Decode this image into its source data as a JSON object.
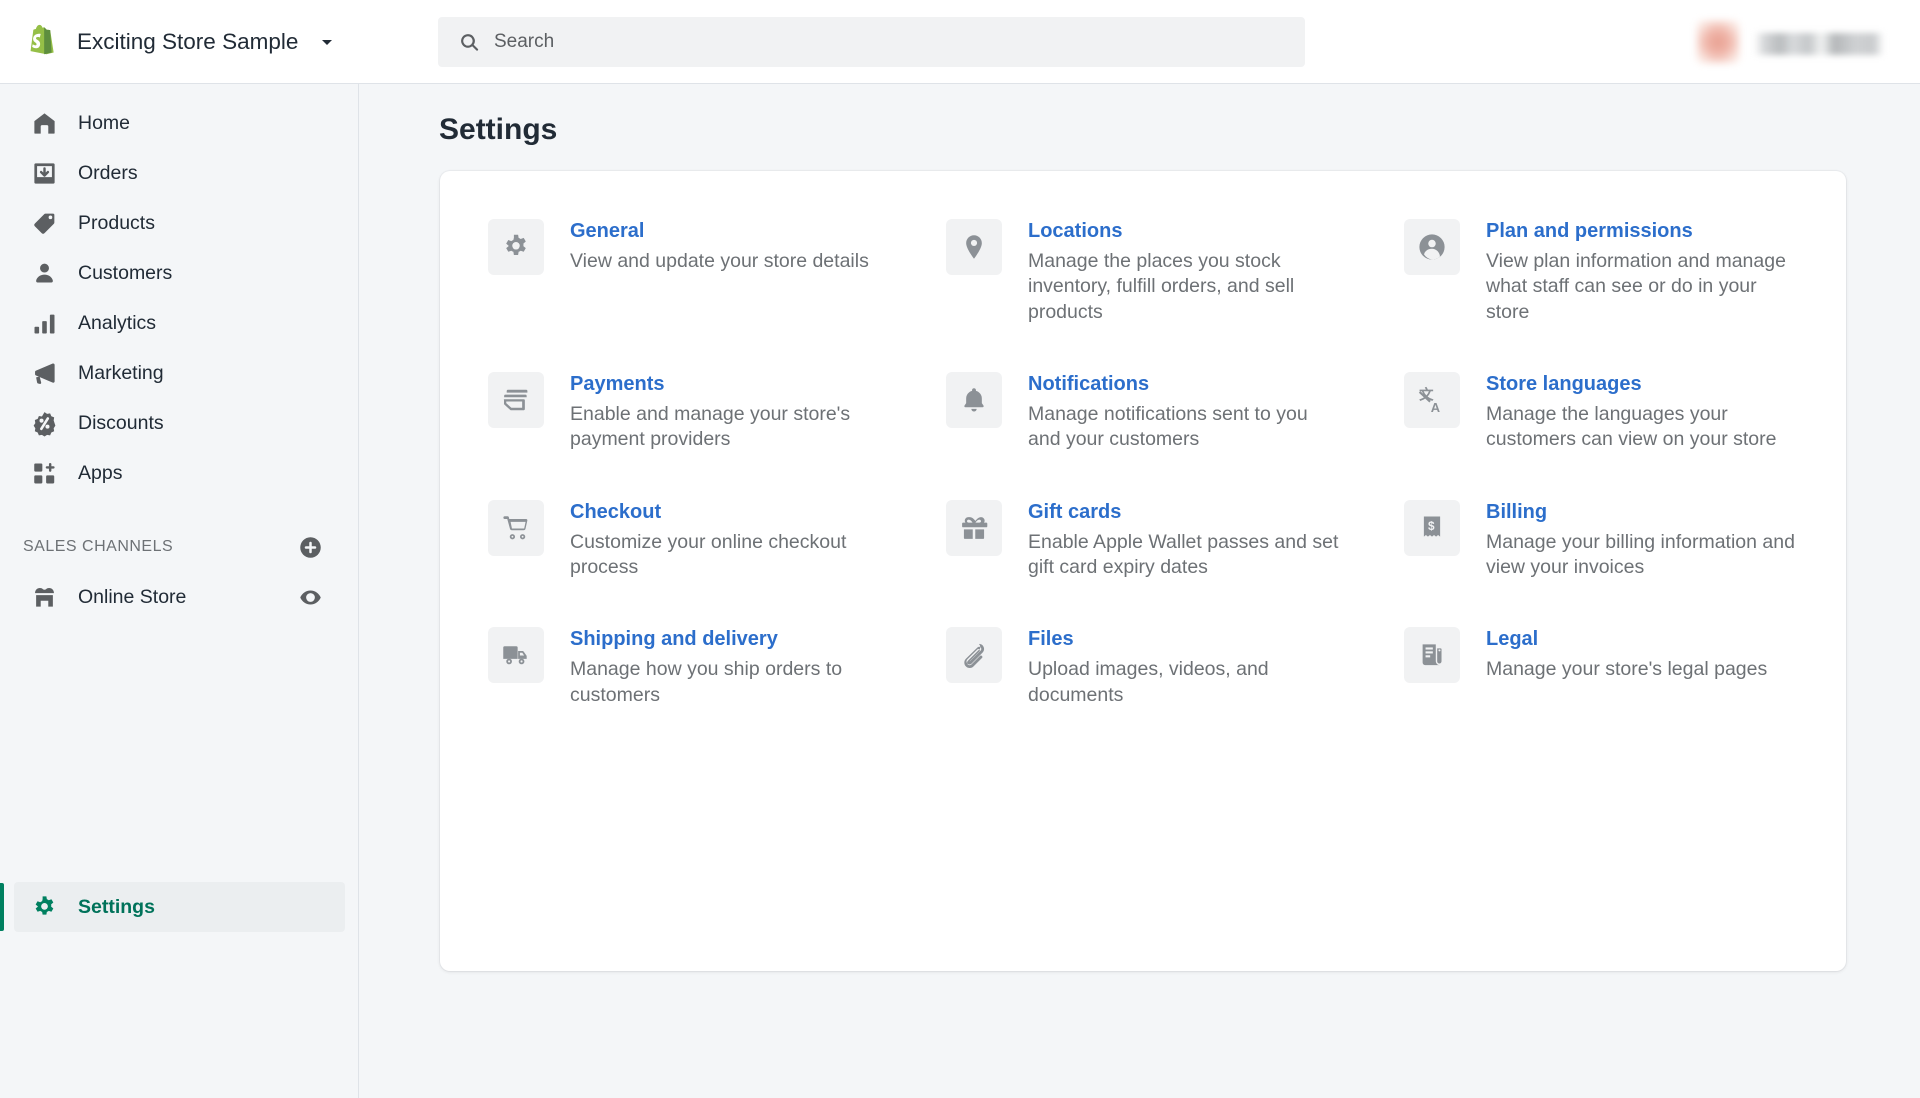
{
  "topbar": {
    "logo_icon": "shopify-bag-icon",
    "store_name": "Exciting Store Sample",
    "store_switcher_icon": "chevron-down-icon",
    "search": {
      "icon": "search-icon",
      "placeholder": "Search",
      "value": ""
    },
    "account": {
      "avatar_icon": "avatar-redacted",
      "name_redacted": ""
    }
  },
  "sidebar": {
    "items": [
      {
        "label": "Home",
        "icon": "home-icon"
      },
      {
        "label": "Orders",
        "icon": "orders-inbox-icon"
      },
      {
        "label": "Products",
        "icon": "product-tag-icon"
      },
      {
        "label": "Customers",
        "icon": "customer-person-icon"
      },
      {
        "label": "Analytics",
        "icon": "analytics-bar-chart-icon"
      },
      {
        "label": "Marketing",
        "icon": "marketing-megaphone-icon"
      },
      {
        "label": "Discounts",
        "icon": "discount-percent-badge-icon"
      },
      {
        "label": "Apps",
        "icon": "apps-grid-plus-icon"
      }
    ],
    "sales_channels": {
      "title": "SALES CHANNELS",
      "add_icon": "plus-circle-icon",
      "channels": [
        {
          "label": "Online Store",
          "icon": "storefront-icon",
          "action_icon": "eye-icon"
        }
      ]
    },
    "settings": {
      "label": "Settings",
      "icon": "gear-icon",
      "active": true,
      "active_color": "#008060"
    }
  },
  "main": {
    "page_title": "Settings",
    "settings_items": [
      {
        "title": "General",
        "description": "View and update your store details",
        "icon": "gear-icon"
      },
      {
        "title": "Locations",
        "description": "Manage the places you stock inventory, fulfill orders, and sell products",
        "icon": "location-pin-icon"
      },
      {
        "title": "Plan and permissions",
        "description": "View plan information and manage what staff can see or do in your store",
        "icon": "person-circle-icon"
      },
      {
        "title": "Payments",
        "description": "Enable and manage your store's payment providers",
        "icon": "credit-cards-icon"
      },
      {
        "title": "Notifications",
        "description": "Manage notifications sent to you and your customers",
        "icon": "bell-icon"
      },
      {
        "title": "Store languages",
        "description": "Manage the languages your customers can view on your store",
        "icon": "translate-icon"
      },
      {
        "title": "Checkout",
        "description": "Customize your online checkout process",
        "icon": "shopping-cart-icon"
      },
      {
        "title": "Gift cards",
        "description": "Enable Apple Wallet passes and set gift card expiry dates",
        "icon": "gift-box-icon"
      },
      {
        "title": "Billing",
        "description": "Manage your billing information and view your invoices",
        "icon": "billing-receipt-icon"
      },
      {
        "title": "Shipping and delivery",
        "description": "Manage how you ship orders to customers",
        "icon": "delivery-truck-icon"
      },
      {
        "title": "Files",
        "description": "Upload images, videos, and documents",
        "icon": "paperclip-icon"
      },
      {
        "title": "Legal",
        "description": "Manage your store's legal pages",
        "icon": "legal-scroll-icon"
      }
    ]
  },
  "colors": {
    "page_background": "#f4f6f8",
    "card_background": "#ffffff",
    "link_blue": "#2c6ecb",
    "text_primary": "#212b36",
    "text_secondary": "#6d7175",
    "brand_green": "#008060",
    "icon_gray": "#8c9196",
    "border": "#dfe3e8"
  }
}
